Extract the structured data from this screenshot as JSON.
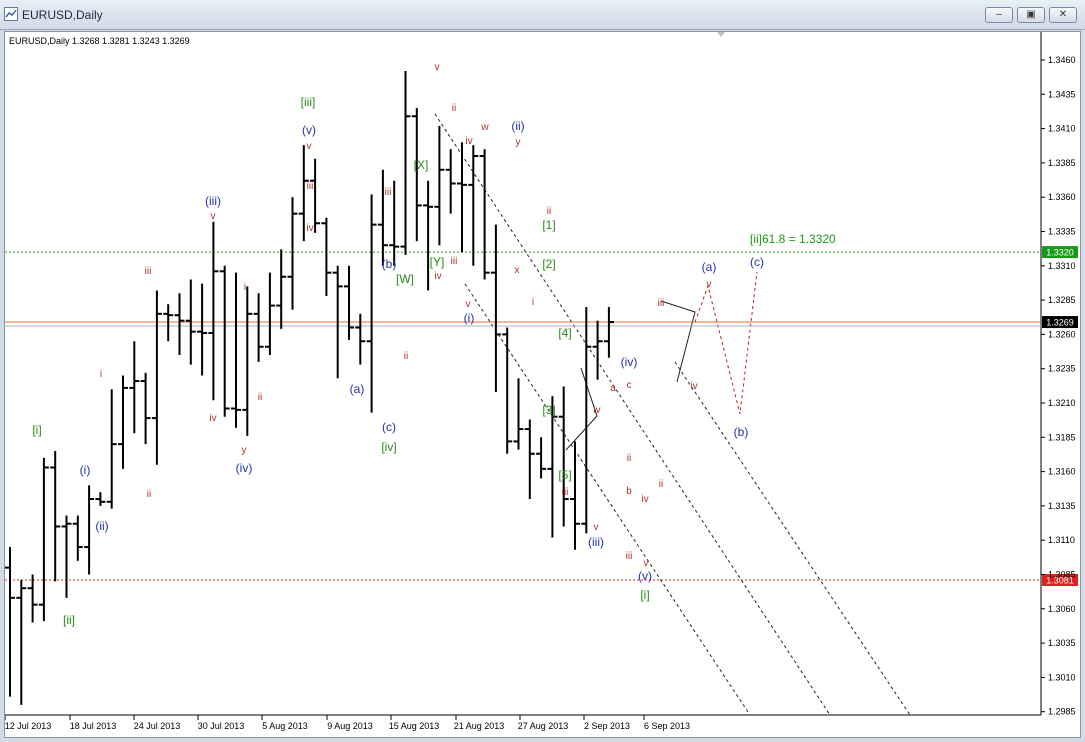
{
  "window": {
    "title": "EURUSD,Daily",
    "buttons": [
      "minimize",
      "restore",
      "close"
    ]
  },
  "chart_data": {
    "type": "ohlc",
    "title": "EURUSD,Daily",
    "ohlc_readout": "1.3268 1.3281 1.3243 1.3269",
    "ylim": [
      2.9848,
      3.4748
    ],
    "y_ticks": [
      "1.3460",
      "1.3435",
      "1.3410",
      "1.3385",
      "1.3360",
      "1.3335",
      "1.3310",
      "1.3285",
      "1.3260",
      "1.3235",
      "1.3210",
      "1.3185",
      "1.3160",
      "1.3135",
      "1.3110",
      "1.3085",
      "1.3060",
      "1.3035",
      "1.3010",
      "1.2985"
    ],
    "x_ticks": [
      "12 Jul 2013",
      "18 Jul 2013",
      "24 Jul 2013",
      "30 Jul 2013",
      "5 Aug 2013",
      "9 Aug 2013",
      "15 Aug 2013",
      "21 Aug 2013",
      "27 Aug 2013",
      "2 Sep 2013",
      "6 Sep 2013"
    ],
    "bars": [
      {
        "o": 1.309,
        "h": 1.3105,
        "l": 1.2996,
        "c": 1.3068
      },
      {
        "o": 1.3068,
        "h": 1.3081,
        "l": 1.299,
        "c": 1.3075
      },
      {
        "o": 1.3075,
        "h": 1.3085,
        "l": 1.305,
        "c": 1.3063
      },
      {
        "o": 1.3063,
        "h": 1.317,
        "l": 1.3051,
        "c": 1.3163
      },
      {
        "o": 1.3163,
        "h": 1.3175,
        "l": 1.308,
        "c": 1.312
      },
      {
        "o": 1.312,
        "h": 1.3128,
        "l": 1.3068,
        "c": 1.3122
      },
      {
        "o": 1.3122,
        "h": 1.3128,
        "l": 1.3095,
        "c": 1.3105
      },
      {
        "o": 1.3105,
        "h": 1.315,
        "l": 1.3085,
        "c": 1.314
      },
      {
        "o": 1.314,
        "h": 1.3145,
        "l": 1.3135,
        "c": 1.3138
      },
      {
        "o": 1.3138,
        "h": 1.322,
        "l": 1.3133,
        "c": 1.318
      },
      {
        "o": 1.318,
        "h": 1.323,
        "l": 1.3162,
        "c": 1.3221
      },
      {
        "o": 1.3221,
        "h": 1.3255,
        "l": 1.3188,
        "c": 1.3226
      },
      {
        "o": 1.3226,
        "h": 1.3232,
        "l": 1.318,
        "c": 1.3199
      },
      {
        "o": 1.3199,
        "h": 1.3292,
        "l": 1.3165,
        "c": 1.3275
      },
      {
        "o": 1.3275,
        "h": 1.3282,
        "l": 1.3255,
        "c": 1.3274
      },
      {
        "o": 1.3274,
        "h": 1.329,
        "l": 1.3245,
        "c": 1.327
      },
      {
        "o": 1.327,
        "h": 1.33,
        "l": 1.3238,
        "c": 1.3262
      },
      {
        "o": 1.3262,
        "h": 1.3297,
        "l": 1.323,
        "c": 1.3261
      },
      {
        "o": 1.3261,
        "h": 1.3342,
        "l": 1.3212,
        "c": 1.3306
      },
      {
        "o": 1.3306,
        "h": 1.331,
        "l": 1.32,
        "c": 1.3206
      },
      {
        "o": 1.3206,
        "h": 1.3305,
        "l": 1.3192,
        "c": 1.3205
      },
      {
        "o": 1.3205,
        "h": 1.3295,
        "l": 1.3186,
        "c": 1.3275
      },
      {
        "o": 1.3275,
        "h": 1.329,
        "l": 1.324,
        "c": 1.3251
      },
      {
        "o": 1.3251,
        "h": 1.3305,
        "l": 1.3245,
        "c": 1.3281
      },
      {
        "o": 1.3281,
        "h": 1.3322,
        "l": 1.3264,
        "c": 1.3302
      },
      {
        "o": 1.3302,
        "h": 1.336,
        "l": 1.3278,
        "c": 1.3348
      },
      {
        "o": 1.3348,
        "h": 1.3398,
        "l": 1.3328,
        "c": 1.3372
      },
      {
        "o": 1.3372,
        "h": 1.3388,
        "l": 1.3334,
        "c": 1.3341
      },
      {
        "o": 1.3341,
        "h": 1.3345,
        "l": 1.3288,
        "c": 1.3305
      },
      {
        "o": 1.3305,
        "h": 1.331,
        "l": 1.3228,
        "c": 1.3295
      },
      {
        "o": 1.3295,
        "h": 1.331,
        "l": 1.3256,
        "c": 1.3265
      },
      {
        "o": 1.3265,
        "h": 1.3275,
        "l": 1.3238,
        "c": 1.3255
      },
      {
        "o": 1.3255,
        "h": 1.3362,
        "l": 1.3203,
        "c": 1.334
      },
      {
        "o": 1.334,
        "h": 1.338,
        "l": 1.331,
        "c": 1.3325
      },
      {
        "o": 1.3325,
        "h": 1.3372,
        "l": 1.331,
        "c": 1.3324
      },
      {
        "o": 1.3324,
        "h": 1.3452,
        "l": 1.3318,
        "c": 1.3419
      },
      {
        "o": 1.3419,
        "h": 1.3425,
        "l": 1.3328,
        "c": 1.3354
      },
      {
        "o": 1.3354,
        "h": 1.3372,
        "l": 1.3292,
        "c": 1.3353
      },
      {
        "o": 1.3353,
        "h": 1.3412,
        "l": 1.3325,
        "c": 1.338
      },
      {
        "o": 1.338,
        "h": 1.3395,
        "l": 1.3348,
        "c": 1.337
      },
      {
        "o": 1.337,
        "h": 1.34,
        "l": 1.332,
        "c": 1.3369
      },
      {
        "o": 1.3369,
        "h": 1.3398,
        "l": 1.331,
        "c": 1.339
      },
      {
        "o": 1.339,
        "h": 1.3395,
        "l": 1.33,
        "c": 1.3305
      },
      {
        "o": 1.3305,
        "h": 1.334,
        "l": 1.3218,
        "c": 1.326
      },
      {
        "o": 1.326,
        "h": 1.3265,
        "l": 1.3173,
        "c": 1.3182
      },
      {
        "o": 1.3182,
        "h": 1.3228,
        "l": 1.3176,
        "c": 1.3191
      },
      {
        "o": 1.3191,
        "h": 1.3198,
        "l": 1.314,
        "c": 1.3173
      },
      {
        "o": 1.3173,
        "h": 1.3185,
        "l": 1.3155,
        "c": 1.3162
      },
      {
        "o": 1.3162,
        "h": 1.3215,
        "l": 1.3112,
        "c": 1.32
      },
      {
        "o": 1.32,
        "h": 1.3222,
        "l": 1.312,
        "c": 1.314
      },
      {
        "o": 1.314,
        "h": 1.3182,
        "l": 1.3103,
        "c": 1.3122
      },
      {
        "o": 1.3122,
        "h": 1.328,
        "l": 1.3115,
        "c": 1.3251
      },
      {
        "o": 1.3251,
        "h": 1.327,
        "l": 1.3227,
        "c": 1.3255
      },
      {
        "o": 1.3255,
        "h": 1.328,
        "l": 1.3243,
        "c": 1.3269
      }
    ],
    "horizontal_lines": [
      {
        "price": 1.332,
        "label": "1.3320",
        "color": "#1a9a1a",
        "style": "dotted"
      },
      {
        "price": 1.3269,
        "label": "1.3269",
        "color": "#e07030",
        "style": "solid"
      },
      {
        "price": 1.3081,
        "label": "1.3081",
        "color": "#e02020",
        "style": "dotted"
      }
    ],
    "annotation": "[ii]61.8 = 1.3320",
    "wave_labels": [
      {
        "t": "[i]",
        "c": "g"
      },
      {
        "t": "[ii]",
        "c": "g"
      },
      {
        "t": "i",
        "c": "r"
      },
      {
        "t": "(i)",
        "c": "b"
      },
      {
        "t": "(ii)",
        "c": "b"
      },
      {
        "t": "ii",
        "c": "r"
      },
      {
        "t": "iii",
        "c": "r"
      },
      {
        "t": "iv",
        "c": "r"
      },
      {
        "t": "(iii)",
        "c": "b"
      },
      {
        "t": "v",
        "c": "r"
      },
      {
        "t": "i",
        "c": "r"
      },
      {
        "t": "ii",
        "c": "r"
      },
      {
        "t": "y",
        "c": "r"
      },
      {
        "t": "(iv)",
        "c": "b"
      },
      {
        "t": "[iii]",
        "c": "g"
      },
      {
        "t": "(v)",
        "c": "b"
      },
      {
        "t": "v",
        "c": "r"
      },
      {
        "t": "iii",
        "c": "r"
      },
      {
        "t": "iv",
        "c": "r"
      },
      {
        "t": "(a)",
        "c": "b"
      },
      {
        "t": "iii",
        "c": "r"
      },
      {
        "t": "(b)",
        "c": "b"
      },
      {
        "t": "ii",
        "c": "r"
      },
      {
        "t": "(c)",
        "c": "b"
      },
      {
        "t": "[iv]",
        "c": "g"
      },
      {
        "t": "[W]",
        "c": "g"
      },
      {
        "t": "[X]",
        "c": "g"
      },
      {
        "t": "[Y]",
        "c": "g"
      },
      {
        "t": "iv",
        "c": "r"
      },
      {
        "t": "v",
        "c": "r"
      },
      {
        "t": "ii",
        "c": "r"
      },
      {
        "t": "iv",
        "c": "r"
      },
      {
        "t": "iii",
        "c": "r"
      },
      {
        "t": "v",
        "c": "r"
      },
      {
        "t": "(i)",
        "c": "b"
      },
      {
        "t": "w",
        "c": "r"
      },
      {
        "t": "(ii)",
        "c": "b"
      },
      {
        "t": "y",
        "c": "r"
      },
      {
        "t": "x",
        "c": "r"
      },
      {
        "t": "i",
        "c": "r"
      },
      {
        "t": "ii",
        "c": "r"
      },
      {
        "t": "[1]",
        "c": "g"
      },
      {
        "t": "[2]",
        "c": "g"
      },
      {
        "t": "[3]",
        "c": "g"
      },
      {
        "t": "[4]",
        "c": "g"
      },
      {
        "t": "[5]",
        "c": "g"
      },
      {
        "t": "iii",
        "c": "r"
      },
      {
        "t": "v",
        "c": "r"
      },
      {
        "t": "(iii)",
        "c": "b"
      },
      {
        "t": "iv",
        "c": "r"
      },
      {
        "t": "a",
        "c": "r"
      },
      {
        "t": "(iv)",
        "c": "b"
      },
      {
        "t": "c",
        "c": "r"
      },
      {
        "t": "b",
        "c": "r"
      },
      {
        "t": "ii",
        "c": "r"
      },
      {
        "t": "iii",
        "c": "r"
      },
      {
        "t": "iv",
        "c": "r"
      },
      {
        "t": "v",
        "c": "r"
      },
      {
        "t": "(v)",
        "c": "b"
      },
      {
        "t": "[i]",
        "c": "g"
      },
      {
        "t": "iii",
        "c": "r"
      },
      {
        "t": "ii",
        "c": "r"
      },
      {
        "t": "iv",
        "c": "r"
      },
      {
        "t": "v",
        "c": "r"
      },
      {
        "t": "(a)",
        "c": "b"
      },
      {
        "t": "(b)",
        "c": "b"
      },
      {
        "t": "(c)",
        "c": "b"
      }
    ],
    "colors": {
      "green": "#2a8a1a",
      "red": "#a83228",
      "blue": "#2030b0"
    },
    "grid": false
  }
}
